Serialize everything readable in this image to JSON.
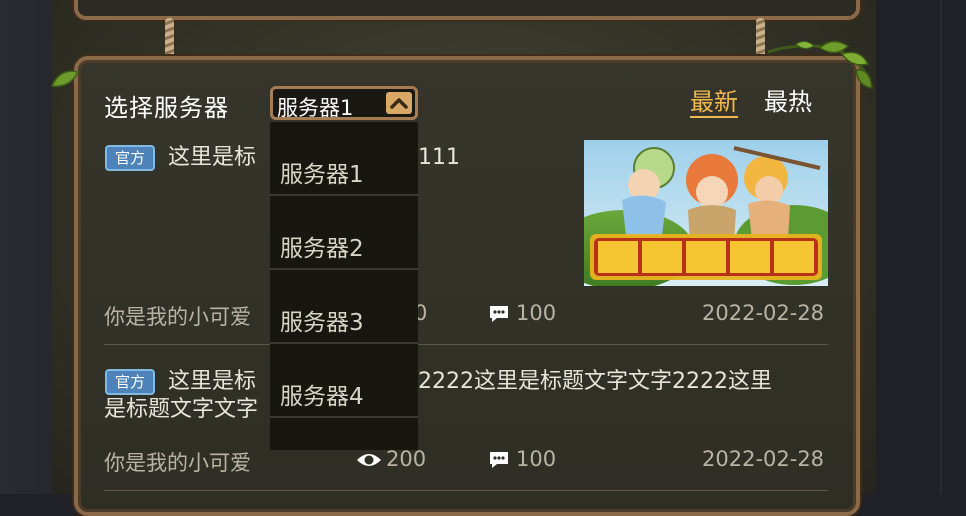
{
  "header": {
    "select_label": "选择服务器",
    "selected_server": "服务器1",
    "tabs": [
      {
        "label": "最新",
        "active": true
      },
      {
        "label": "最热",
        "active": false
      }
    ]
  },
  "dropdown": {
    "options": [
      "服务器1",
      "服务器2",
      "服务器3",
      "服务器4"
    ]
  },
  "posts": [
    {
      "badge": "官方",
      "title_line1": "这里是标",
      "title_line1_tail": "111",
      "author": "你是我的小可爱",
      "views_tail": "0",
      "comments": "100",
      "date": "2022-02-28",
      "thumbnail_icon": "game-banner-image"
    },
    {
      "badge": "官方",
      "title_line1": "这里是标",
      "title_line1_tail": "2222这里是标题文字文字2222这里",
      "title_line2": "是标题文字文字",
      "author": "你是我的小可爱",
      "views": "200",
      "comments": "100",
      "date": "2022-02-28"
    }
  ],
  "colors": {
    "accent": "#f1b84d",
    "frame": "#8a6a48",
    "badge": "#4d83b8"
  }
}
